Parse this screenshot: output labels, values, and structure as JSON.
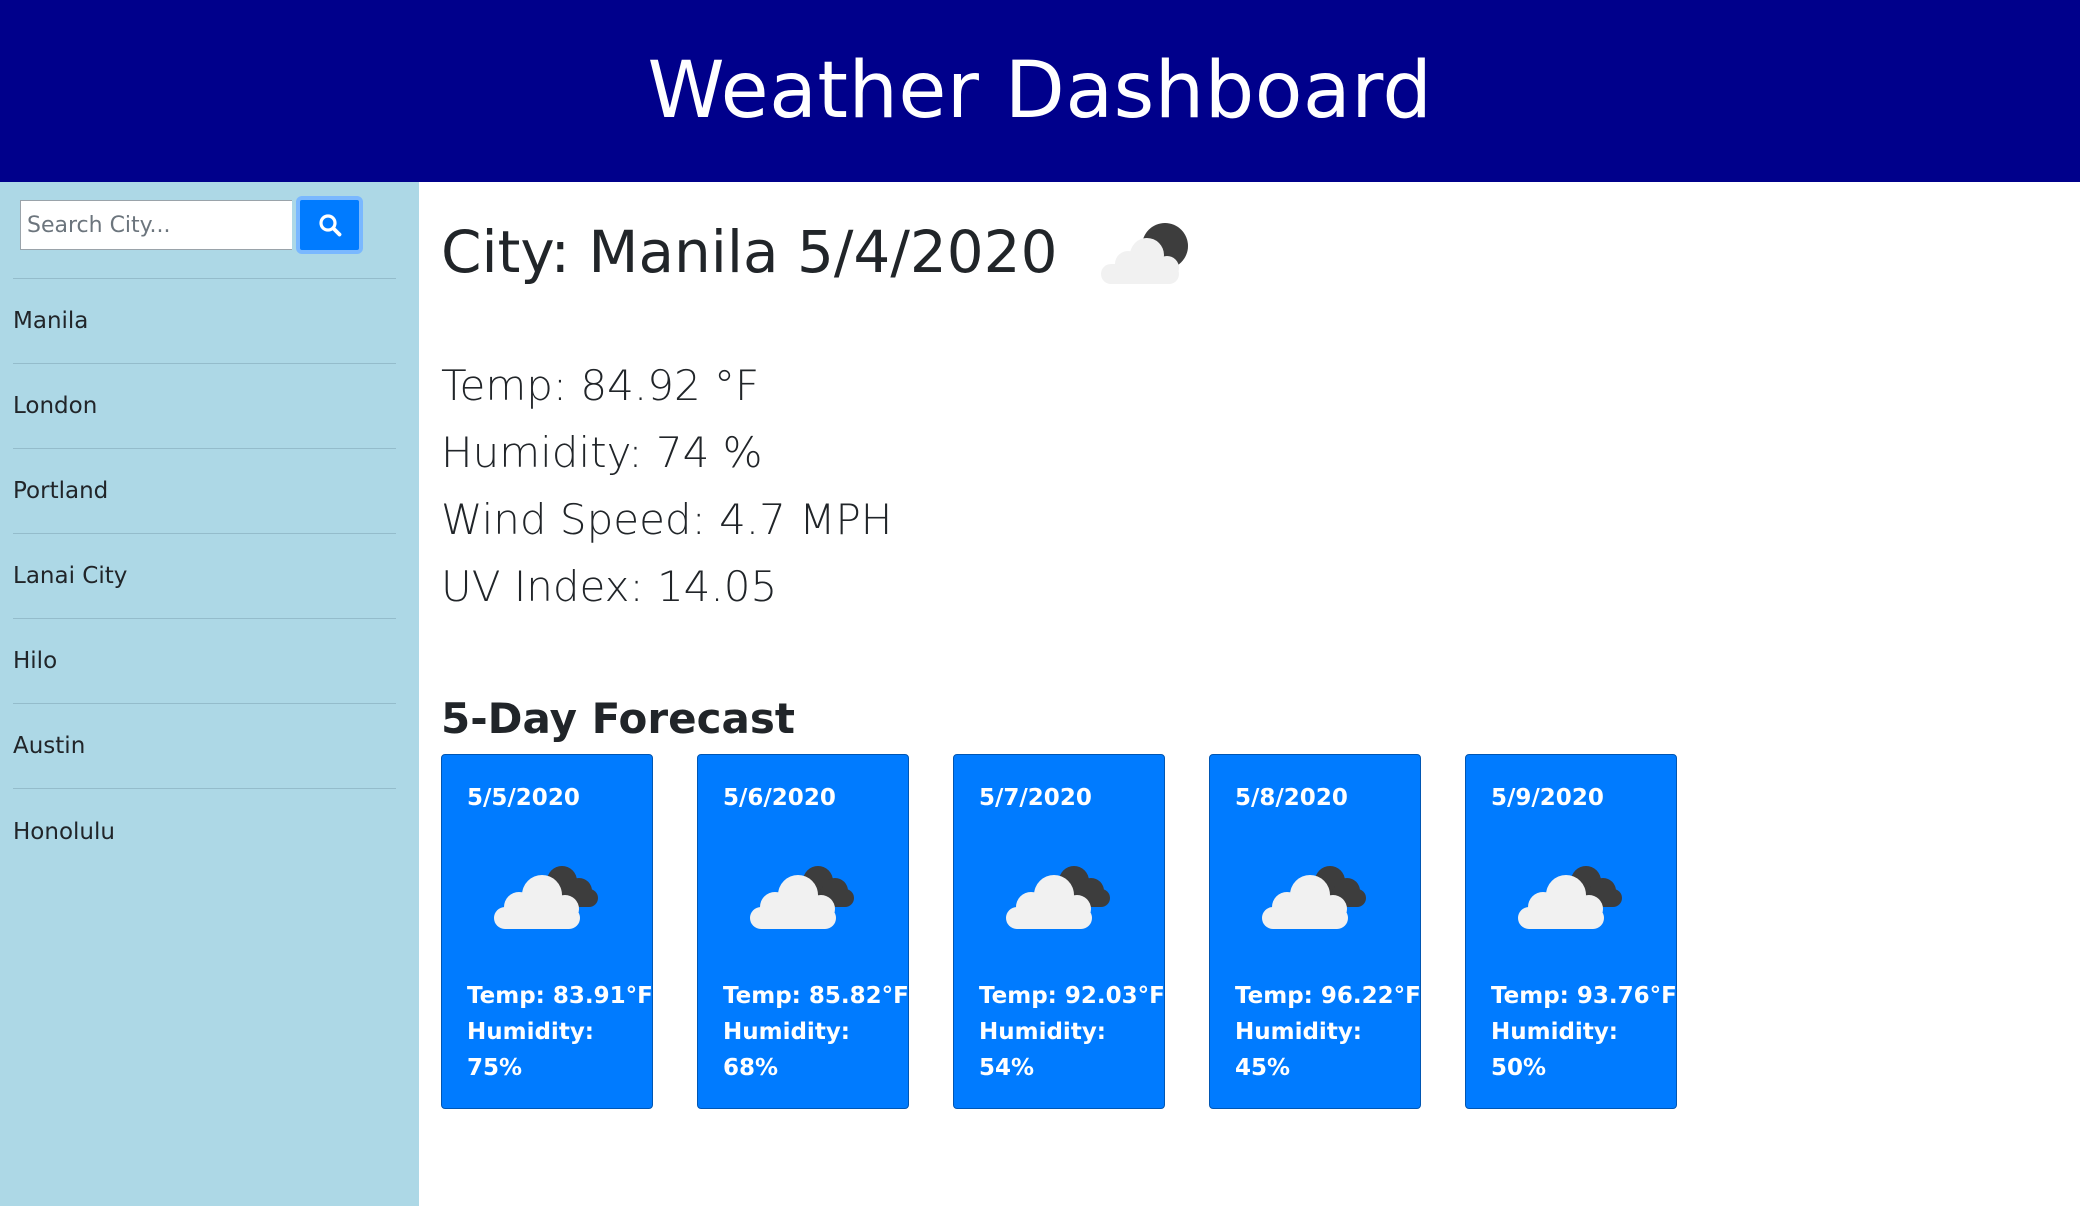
{
  "header": {
    "title": "Weather Dashboard"
  },
  "search": {
    "placeholder": "Search City...",
    "value": ""
  },
  "sidebar": {
    "cities": [
      "Manila",
      "London",
      "Portland",
      "Lanai City",
      "Hilo",
      "Austin",
      "Honolulu"
    ]
  },
  "current": {
    "title": "City: Manila 5/4/2020",
    "icon": "partly-cloudy-night-icon",
    "temp": "Temp: 84.92 °F",
    "humidity": "Humidity: 74 %",
    "wind": "Wind Speed: 4.7 MPH",
    "uv": "UV Index: 14.05"
  },
  "forecast": {
    "title": "5-Day Forecast",
    "days": [
      {
        "date": "5/5/2020",
        "icon": "cloudy-night-icon",
        "temp": "Temp: 83.91°F",
        "humidity_label": "Humidity:",
        "humidity_value": "75%"
      },
      {
        "date": "5/6/2020",
        "icon": "cloudy-night-icon",
        "temp": "Temp: 85.82°F",
        "humidity_label": "Humidity:",
        "humidity_value": "68%"
      },
      {
        "date": "5/7/2020",
        "icon": "cloudy-night-icon",
        "temp": "Temp: 92.03°F",
        "humidity_label": "Humidity:",
        "humidity_value": "54%"
      },
      {
        "date": "5/8/2020",
        "icon": "cloudy-night-icon",
        "temp": "Temp: 96.22°F",
        "humidity_label": "Humidity:",
        "humidity_value": "45%"
      },
      {
        "date": "5/9/2020",
        "icon": "cloudy-night-icon",
        "temp": "Temp: 93.76°F",
        "humidity_label": "Humidity:",
        "humidity_value": "50%"
      }
    ]
  },
  "colors": {
    "header_bg": "#00008b",
    "sidebar_bg": "#add8e6",
    "card_bg": "#007bff",
    "button_bg": "#007bff"
  }
}
